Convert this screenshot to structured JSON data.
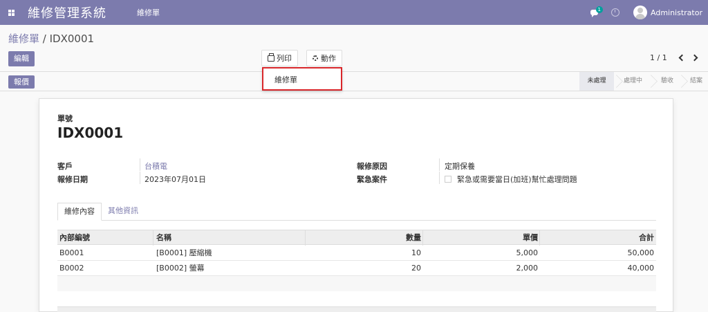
{
  "navbar": {
    "app_title": "維修管理系統",
    "menu": "維修單",
    "chat_badge": "1",
    "user": "Administrator"
  },
  "breadcrumb": {
    "parent": "維修單",
    "separator": " / ",
    "current": "IDX0001"
  },
  "toolbar": {
    "edit_label": "編輯",
    "print_label": "列印",
    "action_label": "動作",
    "pager": "1 / 1",
    "quote_label": "報價"
  },
  "print_dropdown": {
    "item": "維修單"
  },
  "status": {
    "stages": [
      "未處理",
      "處理中",
      "驗收",
      "結案"
    ],
    "current": "未處理"
  },
  "form": {
    "no_label": "單號",
    "no_value": "IDX0001",
    "customer_label": "客戶",
    "customer_value": "台積電",
    "date_label": "報修日期",
    "date_value": "2023年07月01日",
    "reason_label": "報修原因",
    "reason_value": "定期保養",
    "urgent_label": "緊急案件",
    "urgent_text": "緊急或需要當日(加班)幫忙處理問題"
  },
  "tabs": [
    "維修內容",
    "其他資訊"
  ],
  "table": {
    "headers": [
      "內部編號",
      "名稱",
      "數量",
      "單價",
      "合計"
    ],
    "rows": [
      [
        "B0001",
        "[B0001] 壓縮機",
        "10",
        "5,000",
        "50,000"
      ],
      [
        "B0002",
        "[B0002] 螢幕",
        "20",
        "2,000",
        "40,000"
      ]
    ]
  },
  "colors": {
    "brand": "#7c7bad",
    "highlight": "#d9262a",
    "badge": "#00a09d"
  }
}
